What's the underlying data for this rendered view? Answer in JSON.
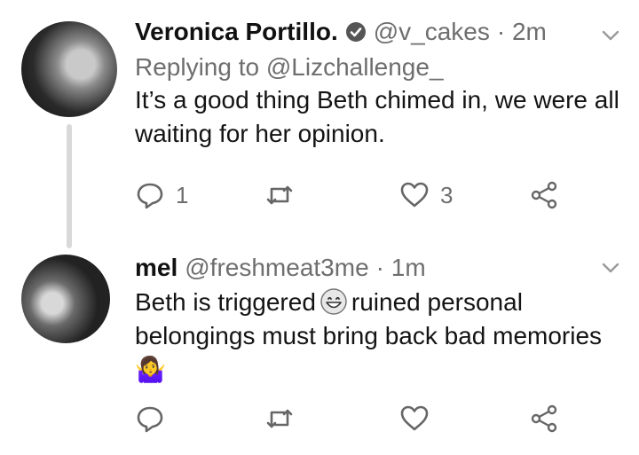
{
  "tweets": [
    {
      "name": "Veronica Portillo.",
      "handle": "@v_cakes",
      "time": "· 2m",
      "verified": true,
      "replying_to": "Replying to @Lizchallenge_",
      "text": "It’s a good thing Beth chimed in, we were all waiting for her opinion.",
      "reply_count": "1",
      "retweet_count": "",
      "like_count": "3"
    },
    {
      "name": "mel",
      "handle": "@freshmeat3me",
      "time": "· 1m",
      "text_before_emoji": "Beth is triggered",
      "text_after_emoji": "ruined personal belongings must bring back bad memories 🤷‍♀",
      "reply_count": "",
      "retweet_count": "",
      "like_count": ""
    }
  ],
  "icons": {
    "reply": "reply-icon",
    "retweet": "retweet-icon",
    "like": "heart-icon",
    "share": "share-icon",
    "more": "chevron-down-icon",
    "verified": "verified-badge-icon",
    "emoji": "grinning-face-emoji"
  },
  "colors": {
    "text": "#141414",
    "muted": "#6e6e6e",
    "thread_line": "#d9d9d9",
    "background": "#ffffff"
  }
}
